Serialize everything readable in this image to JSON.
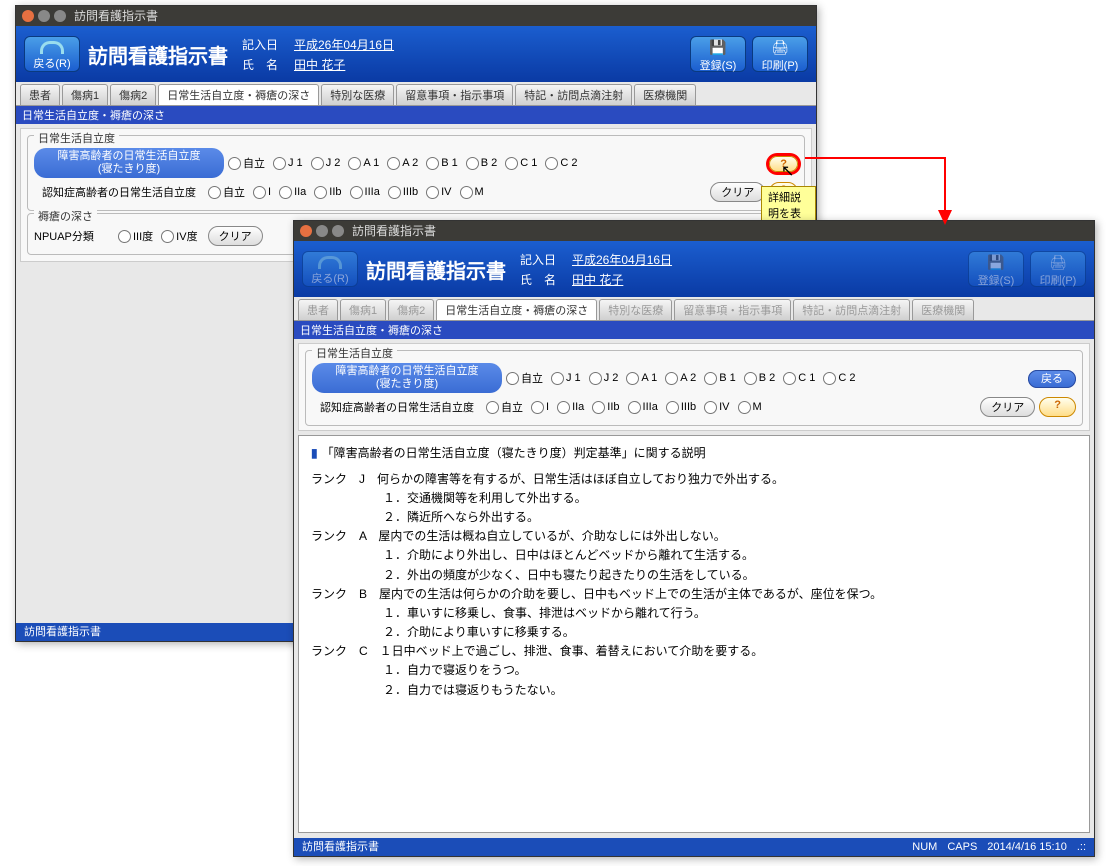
{
  "win1": {
    "title": "訪問看護指示書",
    "back": "戻る(R)",
    "appTitle": "訪問看護指示書",
    "metaDateLbl": "記入日",
    "metaDate": "平成26年04月16日",
    "metaNameLbl": "氏　名",
    "metaName": "田中 花子",
    "btnReg": "登録(S)",
    "btnPrint": "印刷(P)",
    "tabs": [
      "患者",
      "傷病1",
      "傷病2",
      "日常生活自立度・褥瘡の深さ",
      "特別な医療",
      "留意事項・指示事項",
      "特記・訪問点滴注射",
      "医療機関"
    ],
    "section": "日常生活自立度・褥瘡の深さ",
    "fsADL": "日常生活自立度",
    "pill1a": "障害高齢者の日常生活自立度",
    "pill1b": "(寝たきり度)",
    "radios1": [
      "自立",
      "J 1",
      "J 2",
      "A 1",
      "A 2",
      "B 1",
      "B 2",
      "C 1",
      "C 2"
    ],
    "lbl2": "認知症高齢者の日常生活自立度",
    "radios2": [
      "自立",
      "I",
      "IIa",
      "IIb",
      "IIIa",
      "IIIb",
      "IV",
      "M"
    ],
    "clear": "クリア",
    "help": "?",
    "tooltip": "詳細説明を表示します。",
    "fsDepth": "褥瘡の深さ",
    "depthLbl": "NPUAP分類",
    "depthRadios": [
      "III度",
      "IV度"
    ],
    "statusL": "訪問看護指示書"
  },
  "win2": {
    "title": "訪問看護指示書",
    "back": "戻る(R)",
    "appTitle": "訪問看護指示書",
    "metaDateLbl": "記入日",
    "metaDate": "平成26年04月16日",
    "metaNameLbl": "氏　名",
    "metaName": "田中 花子",
    "btnReg": "登録(S)",
    "btnPrint": "印刷(P)",
    "tabs": [
      "患者",
      "傷病1",
      "傷病2",
      "日常生活自立度・褥瘡の深さ",
      "特別な医療",
      "留意事項・指示事項",
      "特記・訪問点滴注射",
      "医療機関"
    ],
    "section": "日常生活自立度・褥瘡の深さ",
    "fsADL": "日常生活自立度",
    "pill1a": "障害高齢者の日常生活自立度",
    "pill1b": "(寝たきり度)",
    "radios1": [
      "自立",
      "J 1",
      "J 2",
      "A 1",
      "A 2",
      "B 1",
      "B 2",
      "C 1",
      "C 2"
    ],
    "lbl2": "認知症高齢者の日常生活自立度",
    "radios2": [
      "自立",
      "I",
      "IIa",
      "IIb",
      "IIIa",
      "IIIb",
      "IV",
      "M"
    ],
    "clear": "クリア",
    "backSm": "戻る",
    "help": "?",
    "explainTitle": "「障害高齢者の日常生活自立度（寝たきり度）判定基準」に関する説明",
    "expl": [
      "ランク　J　何らかの障害等を有するが、日常生活はほぼ自立しており独力で外出する。",
      "　　　　　　１．交通機関等を利用して外出する。",
      "　　　　　　２．隣近所へなら外出する。",
      "ランク　A　屋内での生活は概ね自立しているが、介助なしには外出しない。",
      "　　　　　　１．介助により外出し、日中はほとんどベッドから離れて生活する。",
      "　　　　　　２．外出の頻度が少なく、日中も寝たり起きたりの生活をしている。",
      "",
      "ランク　B　屋内での生活は何らかの介助を要し、日中もベッド上での生活が主体であるが、座位を保つ。",
      "　　　　　　１．車いすに移乗し、食事、排泄はベッドから離れて行う。",
      "　　　　　　２．介助により車いすに移乗する。",
      "",
      "ランク　C　１日中ベッド上で過ごし、排泄、食事、着替えにおいて介助を要する。",
      "　　　　　　１．自力で寝返りをうつ。",
      "　　　　　　２．自力では寝返りもうたない。"
    ],
    "statusL": "訪問看護指示書",
    "statusNUM": "NUM",
    "statusCAPS": "CAPS",
    "statusTime": "2014/4/16 15:10"
  }
}
